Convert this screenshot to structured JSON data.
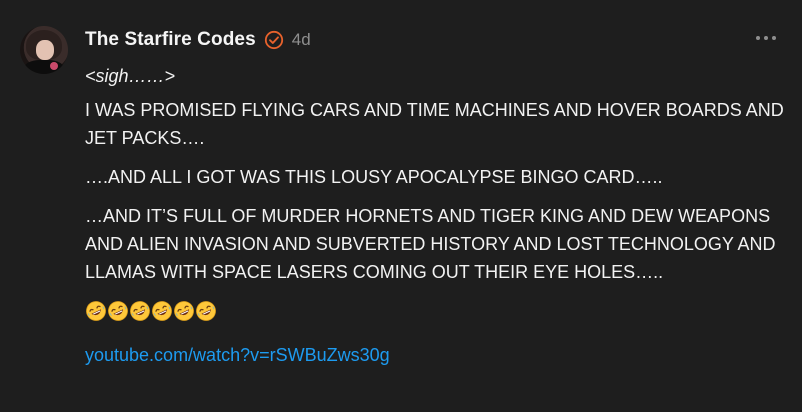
{
  "post": {
    "author": "The Starfire Codes",
    "timestamp": "4d",
    "verified_icon": "verified-check-icon",
    "verified_color": "#e8622c",
    "more_icon": "more-horizontal-icon",
    "sigh": "<sigh……>",
    "paragraphs": [
      "I WAS PROMISED FLYING CARS AND TIME MACHINES AND HOVER BOARDS AND JET PACKS….",
      "….AND ALL I GOT WAS THIS LOUSY APOCALYPSE BINGO CARD…..",
      "…AND IT’S FULL OF MURDER HORNETS AND TIGER KING AND DEW WEAPONS AND ALIEN INVASION AND SUBVERTED HISTORY AND LOST TECHNOLOGY AND LLAMAS WITH SPACE LASERS COMING OUT THEIR EYE HOLES….."
    ],
    "emojis": [
      "🤣",
      "🤣",
      "🤣",
      "🤣",
      "🤣",
      "🤣"
    ],
    "emoji_name": "rolling-on-floor-laughing-icon",
    "link_text": "youtube.com/watch?v=rSWBuZws30g",
    "link_color": "#1d9bf0"
  }
}
